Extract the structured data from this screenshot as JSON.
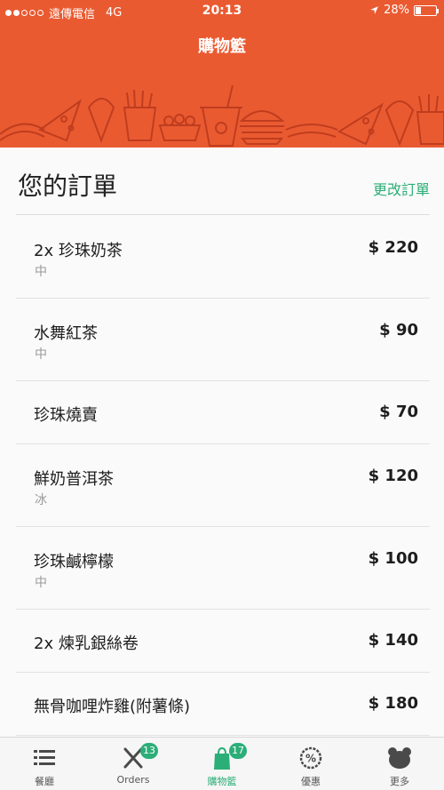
{
  "status_bar": {
    "carrier": "遠傳電信",
    "network": "4G",
    "time": "20:13",
    "battery": "28%",
    "battery_level": 0.28,
    "signal_bars_filled": 2,
    "signal_bars_total": 5
  },
  "header": {
    "title": "購物籃"
  },
  "order": {
    "title": "您的訂單",
    "edit_label": "更改訂單",
    "items": [
      {
        "name": "2x 珍珠奶茶",
        "price": "$ 220",
        "option": "中"
      },
      {
        "name": "水舞紅茶",
        "price": "$ 90",
        "option": "中"
      },
      {
        "name": "珍珠燒賣",
        "price": "$ 70",
        "option": ""
      },
      {
        "name": "鮮奶普洱茶",
        "price": "$ 120",
        "option": "冰"
      },
      {
        "name": "珍珠鹹檸檬",
        "price": "$ 100",
        "option": "中"
      },
      {
        "name": "2x 煉乳銀絲卷",
        "price": "$ 140",
        "option": ""
      },
      {
        "name": "無骨咖哩炸雞(附薯條)",
        "price": "$ 180",
        "option": ""
      }
    ]
  },
  "tabbar": {
    "tabs": [
      {
        "label": "餐廳",
        "icon": "list-icon",
        "badge": ""
      },
      {
        "label": "Orders",
        "icon": "fork-knife-icon",
        "badge": "13"
      },
      {
        "label": "購物籃",
        "icon": "shopping-bag-icon",
        "badge": "17"
      },
      {
        "label": "優惠",
        "icon": "discount-icon",
        "badge": ""
      },
      {
        "label": "更多",
        "icon": "bear-icon",
        "badge": ""
      }
    ],
    "active_index": 2
  },
  "colors": {
    "brand": "#ea5a31",
    "accent": "#2bae77",
    "text": "#1d1d1d",
    "muted": "#9a9a9a"
  }
}
